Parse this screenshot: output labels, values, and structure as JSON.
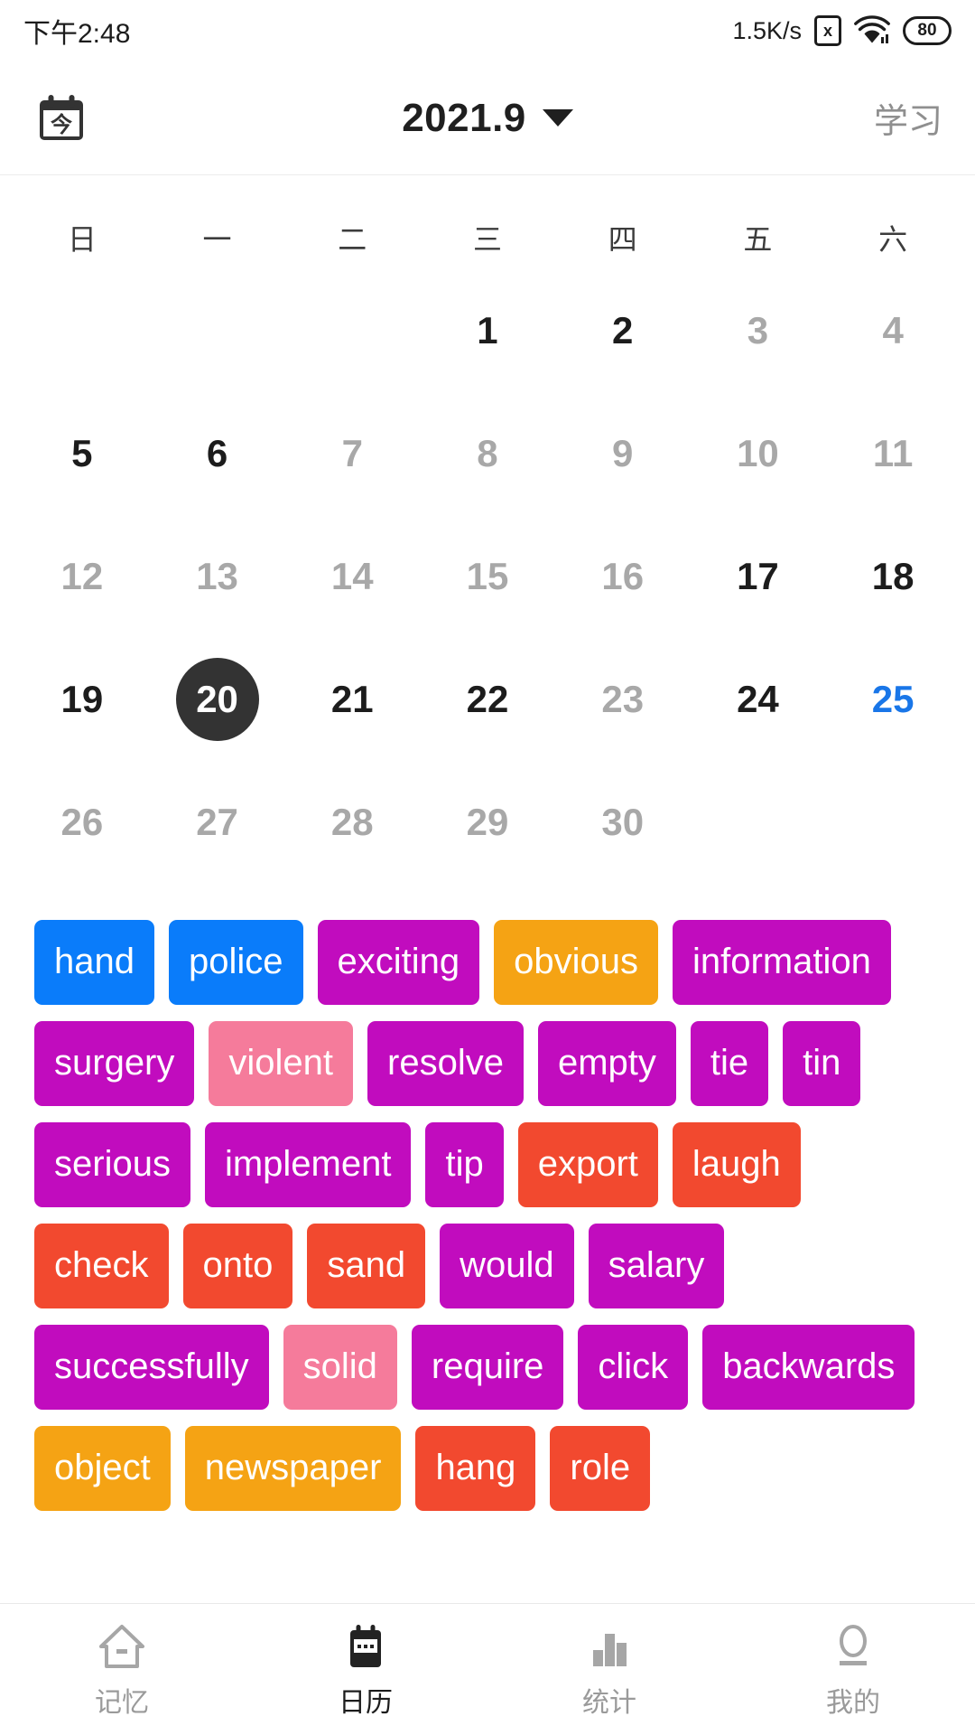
{
  "statusbar": {
    "time": "下午2:48",
    "network_speed": "1.5K/s",
    "no_sim_icon": "x-box-icon",
    "no_sim_label": "x",
    "wifi_icon": "wifi-icon",
    "battery_icon": "battery-icon",
    "battery_level": "80"
  },
  "header": {
    "today_icon": "today-calendar-icon",
    "today_icon_glyph": "今",
    "title": "2021.9",
    "dropdown_icon": "chevron-down-icon",
    "study_label": "学习"
  },
  "calendar": {
    "weekdays": [
      "日",
      "一",
      "二",
      "三",
      "四",
      "五",
      "六"
    ],
    "weeks": [
      [
        {
          "label": "",
          "style": "empty"
        },
        {
          "label": "",
          "style": "empty"
        },
        {
          "label": "",
          "style": "empty"
        },
        {
          "label": "1",
          "style": "dark"
        },
        {
          "label": "2",
          "style": "dark"
        },
        {
          "label": "3",
          "style": "muted"
        },
        {
          "label": "4",
          "style": "muted"
        }
      ],
      [
        {
          "label": "5",
          "style": "dark"
        },
        {
          "label": "6",
          "style": "dark"
        },
        {
          "label": "7",
          "style": "muted"
        },
        {
          "label": "8",
          "style": "muted"
        },
        {
          "label": "9",
          "style": "muted"
        },
        {
          "label": "10",
          "style": "muted"
        },
        {
          "label": "11",
          "style": "muted"
        }
      ],
      [
        {
          "label": "12",
          "style": "muted"
        },
        {
          "label": "13",
          "style": "muted"
        },
        {
          "label": "14",
          "style": "muted"
        },
        {
          "label": "15",
          "style": "muted"
        },
        {
          "label": "16",
          "style": "muted"
        },
        {
          "label": "17",
          "style": "dark"
        },
        {
          "label": "18",
          "style": "dark"
        }
      ],
      [
        {
          "label": "19",
          "style": "dark"
        },
        {
          "label": "20",
          "style": "selected"
        },
        {
          "label": "21",
          "style": "dark"
        },
        {
          "label": "22",
          "style": "dark"
        },
        {
          "label": "23",
          "style": "muted"
        },
        {
          "label": "24",
          "style": "dark"
        },
        {
          "label": "25",
          "style": "accent"
        }
      ],
      [
        {
          "label": "26",
          "style": "muted"
        },
        {
          "label": "27",
          "style": "muted"
        },
        {
          "label": "28",
          "style": "muted"
        },
        {
          "label": "29",
          "style": "muted"
        },
        {
          "label": "30",
          "style": "muted"
        },
        {
          "label": "",
          "style": "empty"
        },
        {
          "label": "",
          "style": "empty"
        }
      ]
    ],
    "selected_day": "20",
    "today_day": "25"
  },
  "colors": {
    "blue": "#0a7cfa",
    "magenta": "#c10cbe",
    "orange": "#f5a314",
    "red": "#f2492f",
    "pink": "#f57b9b",
    "selected_day_bg": "#333333",
    "accent_day": "#1976e8",
    "muted_day": "#a8a8a8"
  },
  "words": [
    {
      "text": "hand",
      "color": "#0a7cfa"
    },
    {
      "text": "police",
      "color": "#0a7cfa"
    },
    {
      "text": "exciting",
      "color": "#c10cbe"
    },
    {
      "text": "obvious",
      "color": "#f5a314"
    },
    {
      "text": "information",
      "color": "#c10cbe"
    },
    {
      "text": "surgery",
      "color": "#c10cbe"
    },
    {
      "text": "violent",
      "color": "#f57b9b"
    },
    {
      "text": "resolve",
      "color": "#c10cbe"
    },
    {
      "text": "empty",
      "color": "#c10cbe"
    },
    {
      "text": "tie",
      "color": "#c10cbe"
    },
    {
      "text": "tin",
      "color": "#c10cbe"
    },
    {
      "text": "serious",
      "color": "#c10cbe"
    },
    {
      "text": "implement",
      "color": "#c10cbe"
    },
    {
      "text": "tip",
      "color": "#c10cbe"
    },
    {
      "text": "export",
      "color": "#f2492f"
    },
    {
      "text": "laugh",
      "color": "#f2492f"
    },
    {
      "text": "check",
      "color": "#f2492f"
    },
    {
      "text": "onto",
      "color": "#f2492f"
    },
    {
      "text": "sand",
      "color": "#f2492f"
    },
    {
      "text": "would",
      "color": "#c10cbe"
    },
    {
      "text": "salary",
      "color": "#c10cbe"
    },
    {
      "text": "successfully",
      "color": "#c10cbe"
    },
    {
      "text": "solid",
      "color": "#f57b9b"
    },
    {
      "text": "require",
      "color": "#c10cbe"
    },
    {
      "text": "click",
      "color": "#c10cbe"
    },
    {
      "text": "backwards",
      "color": "#c10cbe"
    },
    {
      "text": "object",
      "color": "#f5a314"
    },
    {
      "text": "newspaper",
      "color": "#f5a314"
    },
    {
      "text": "hang",
      "color": "#f2492f"
    },
    {
      "text": "role",
      "color": "#f2492f"
    }
  ],
  "bottomnav": {
    "items": [
      {
        "label": "记忆",
        "icon": "home-icon",
        "active": false
      },
      {
        "label": "日历",
        "icon": "calendar-icon",
        "active": true
      },
      {
        "label": "统计",
        "icon": "bar-chart-icon",
        "active": false
      },
      {
        "label": "我的",
        "icon": "person-icon",
        "active": false
      }
    ]
  }
}
